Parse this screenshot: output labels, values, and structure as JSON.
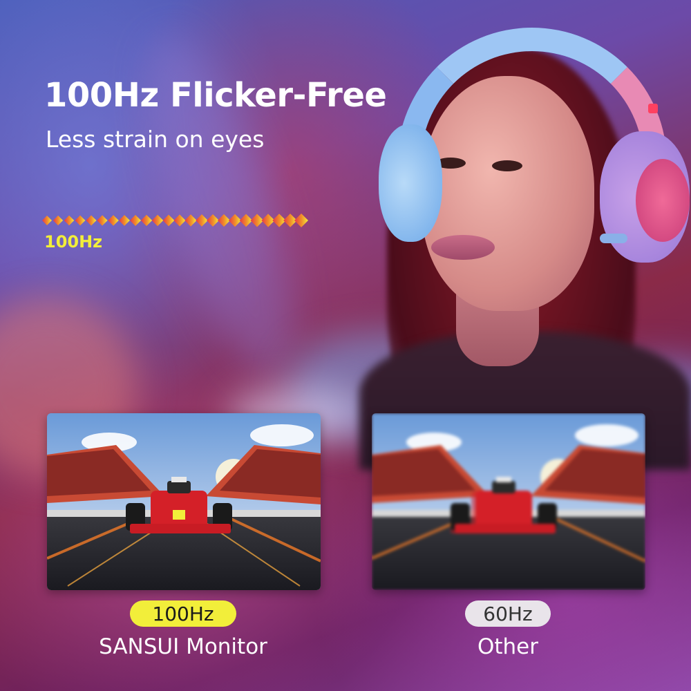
{
  "headline": "100Hz Flicker-Free",
  "subheadline": "Less strain on eyes",
  "wave_label": "100Hz",
  "comparison": {
    "left": {
      "badge": "100Hz",
      "caption": "SANSUI Monitor"
    },
    "right": {
      "badge": "60Hz",
      "caption": "Other"
    }
  },
  "colors": {
    "accent_yellow": "#f2ee3a",
    "wave_start": "#e8344a",
    "wave_end": "#f2ee3a",
    "gray_badge": "#e9e4ea"
  }
}
